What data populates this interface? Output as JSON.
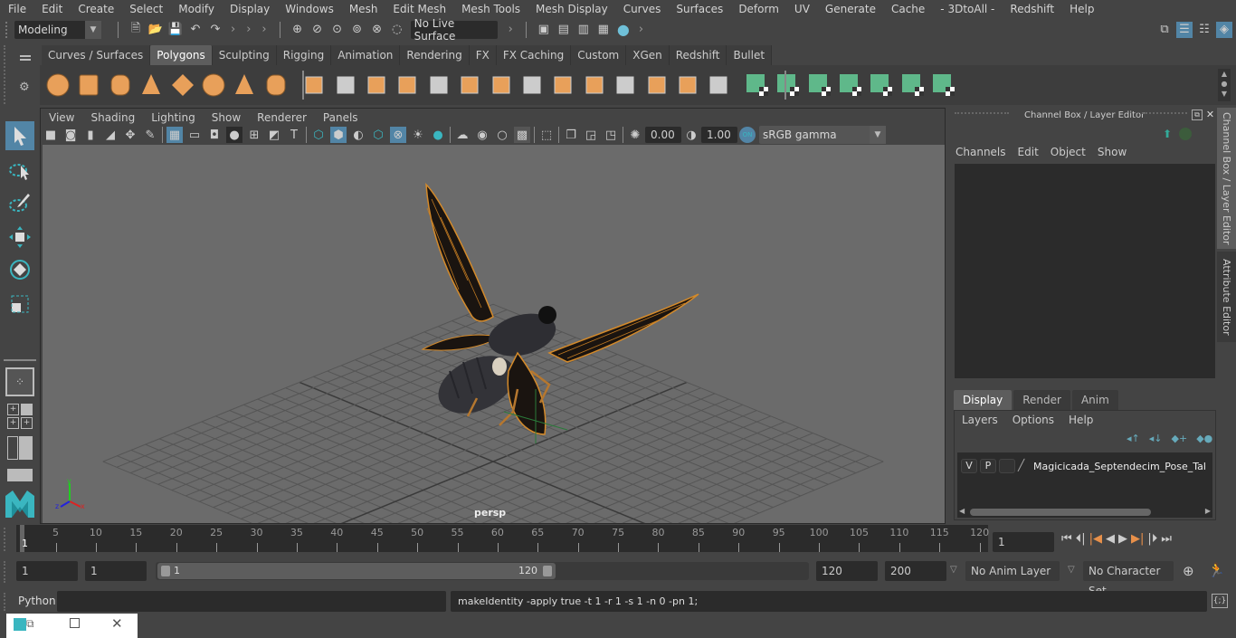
{
  "menubar": [
    "File",
    "Edit",
    "Create",
    "Select",
    "Modify",
    "Display",
    "Windows",
    "Mesh",
    "Edit Mesh",
    "Mesh Tools",
    "Mesh Display",
    "Curves",
    "Surfaces",
    "Deform",
    "UV",
    "Generate",
    "Cache",
    "- 3DtoAll -",
    "Redshift",
    "Help"
  ],
  "status_line": {
    "mode_select": "Modeling",
    "live_surface": "No Live Surface"
  },
  "shelf": {
    "tabs": [
      "Curves / Surfaces",
      "Polygons",
      "Sculpting",
      "Rigging",
      "Animation",
      "Rendering",
      "FX",
      "FX Caching",
      "Custom",
      "XGen",
      "Redshift",
      "Bullet"
    ],
    "active_tab": "Polygons",
    "icons": [
      "poly-sphere-icon",
      "poly-cube-icon",
      "poly-cylinder-icon",
      "poly-cone-icon",
      "poly-plane-icon",
      "poly-torus-icon",
      "poly-pyramid-icon",
      "poly-pipe-icon",
      "combine-icon",
      "separate-icon",
      "mirror-icon",
      "smooth-icon",
      "extract-icon",
      "subdivide-icon",
      "multi-cut-icon",
      "bevel-icon",
      "bridge-icon",
      "extrude-icon",
      "append-icon",
      "fill-hole-icon",
      "merge-icon",
      "target-weld-icon",
      "planar-uv-icon",
      "cylindrical-uv-icon",
      "spherical-uv-icon",
      "automatic-uv-icon",
      "contour-uv-icon",
      "uv-editor-icon",
      "unfold-uv-icon"
    ]
  },
  "viewport": {
    "menus": [
      "View",
      "Shading",
      "Lighting",
      "Show",
      "Renderer",
      "Panels"
    ],
    "exposure": "0.00",
    "gamma": "1.00",
    "color_mgmt_toggle": "ON",
    "color_space": "sRGB gamma",
    "camera_label": "persp",
    "axis": {
      "x": "x",
      "y": "y",
      "z": "z"
    },
    "model": "Magicicada Septendecim cicada"
  },
  "channel_box": {
    "title": "Channel Box / Layer Editor",
    "menus": [
      "Channels",
      "Edit",
      "Object",
      "Show"
    ],
    "layer_tabs": [
      "Display",
      "Render",
      "Anim"
    ],
    "active_layer_tab": "Display",
    "layer_menus": [
      "Layers",
      "Options",
      "Help"
    ],
    "layers": [
      {
        "v": "V",
        "p": "P",
        "name": "Magicicada_Septendecim_Pose_Takeoff"
      }
    ]
  },
  "side_tabs": [
    "Channel Box / Layer Editor",
    "Attribute Editor"
  ],
  "timeline": {
    "ticks": [
      5,
      10,
      15,
      20,
      25,
      30,
      35,
      40,
      45,
      50,
      55,
      60,
      65,
      70,
      75,
      80,
      85,
      90,
      95,
      100,
      105,
      110,
      115,
      120
    ],
    "current_frame_marker": "1",
    "current_frame": "1"
  },
  "range": {
    "start": "1",
    "playback_start": "1",
    "slider_min": "1",
    "slider_max": "120",
    "playback_end": "120",
    "end": "200",
    "anim_layer": "No Anim Layer",
    "character_set": "No Character Set"
  },
  "command_line": {
    "language": "Python",
    "input": "",
    "result": "makeIdentity -apply true -t 1 -r 1 -s 1 -n 0 -pn 1;"
  },
  "colors": {
    "accent_blue": "#5285a6",
    "shelf_orange": "#e8a05a",
    "shelf_green": "#5fb88a",
    "bg": "#444444"
  }
}
